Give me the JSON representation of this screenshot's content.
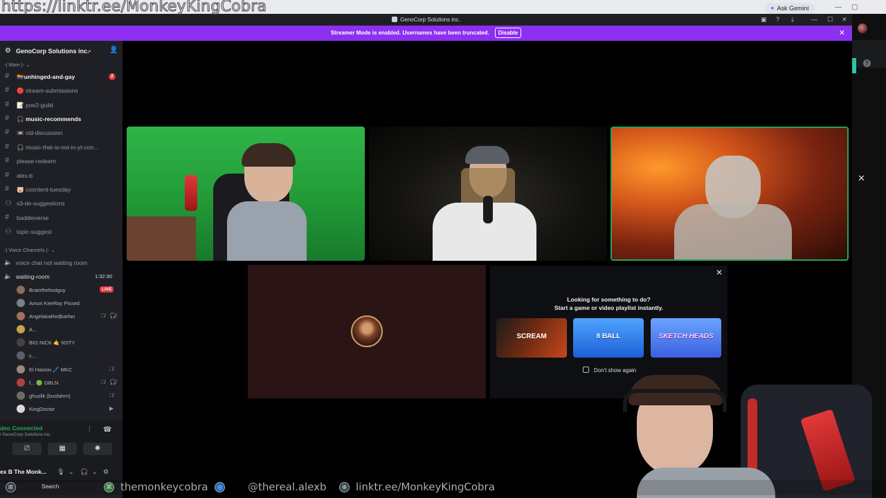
{
  "overlay": {
    "url_text": "https://linktr.ee/MonkeyKingCobra",
    "ticker": {
      "search_label": "Search",
      "handle_1": "themonkeycobra",
      "handle_2": "@thereal.alexb",
      "handle_3": "linktr.ee/MonkeyKingCobra"
    }
  },
  "browser": {
    "gemini_label": "Ask Gemini"
  },
  "app": {
    "window_title": "GenoCorp Solutions inc.",
    "banner_text": "Streamer Mode is enabled. Usernames have been truncated.",
    "banner_button": "Disable"
  },
  "sidebar": {
    "server_name": "GenoCorp Solutions inc.",
    "category_main": "-| Main |-",
    "category_voice": "-| Voice Channels |-",
    "text_channels": [
      {
        "label": "🏳️‍🌈unhinged-and-gay",
        "badge": "2",
        "bold": true
      },
      {
        "label": "🔴 stream-submissions",
        "bold": false
      },
      {
        "label": "📝 poe2-guild",
        "bold": false
      },
      {
        "label": "🎧 music-recommends",
        "bold": true
      },
      {
        "label": "📼 vid-discussion",
        "bold": false
      },
      {
        "label": "🎧 music-that-is-not-in-yt-con...",
        "bold": false
      },
      {
        "label": "please-redeem",
        "bold": false
      },
      {
        "label": "alex-b",
        "bold": false
      },
      {
        "label": "🐷 coontent-tuesday",
        "bold": false
      },
      {
        "label": "s3-de-suggestions",
        "bold": false
      },
      {
        "label": "baddieverse",
        "bold": false
      },
      {
        "label": "topic-suggest",
        "bold": false
      }
    ],
    "voice_channels": [
      {
        "label": "voice chat not waiting room",
        "timer": ""
      },
      {
        "label": "waiting-room",
        "timer": "1:32:30"
      }
    ],
    "voice_users": [
      {
        "name": "Brainthefootguy",
        "live": "LIVE"
      },
      {
        "name": "Amun KeeRay Pissed"
      },
      {
        "name": "AngelakaRedbarfan"
      },
      {
        "name": "A..."
      },
      {
        "name": "BIG NICK 🤙 NSTY"
      },
      {
        "name": "c..."
      },
      {
        "name": "El Hazion 🖊️ MKC"
      },
      {
        "name": "f... 🟢 GBLN"
      },
      {
        "name": "ghuzlik (busfahrn)"
      },
      {
        "name": "KingDoctor"
      }
    ],
    "voice_status": {
      "title": "deo Connected",
      "subtitle": "/ GenoCorp Solutions inc."
    },
    "user": {
      "name": "ex B The Monk..."
    }
  },
  "activity": {
    "line1": "Looking for something to do?",
    "line2": "Start a game or video playlist instantly.",
    "games": [
      {
        "label": "SCREAM",
        "icon": "scream-logo"
      },
      {
        "label": "8 BALL",
        "icon": "eight-ball-logo"
      },
      {
        "label": "SKETCH HEADS",
        "icon": "sketch-heads-logo"
      }
    ],
    "dont_show": "Don't show again"
  },
  "colors": {
    "banner": "#8c2ff0",
    "speaking": "#23a559",
    "live": "#da373c",
    "sidebar": "#1f2026"
  }
}
